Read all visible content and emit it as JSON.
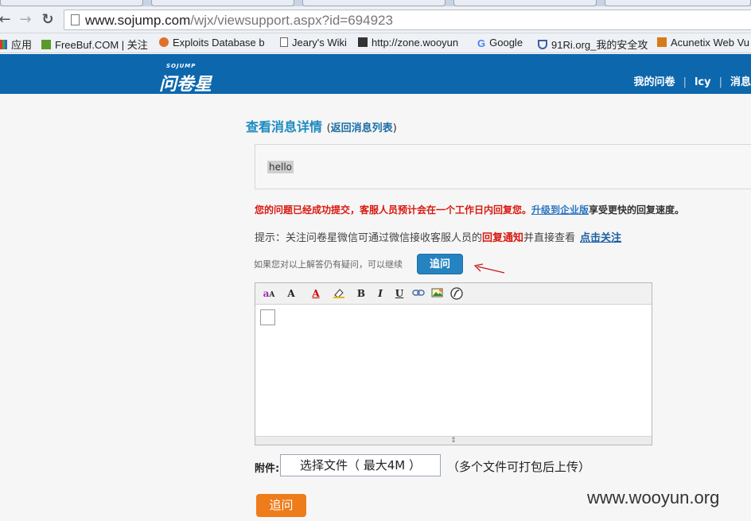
{
  "browser": {
    "url_host": "www.sojump.com",
    "url_path": "/wjx/viewsupport.aspx?id=694923",
    "back_glyph": "←",
    "forward_glyph": "→",
    "reload_glyph": "↻",
    "bookmarks": [
      {
        "label": "应用"
      },
      {
        "label": "FreeBuf.COM | 关注"
      },
      {
        "label": "Exploits Database b"
      },
      {
        "label": "Jeary's Wiki"
      },
      {
        "label": "http://zone.wooyun"
      },
      {
        "label": "Google"
      },
      {
        "label": "91Ri.org_我的安全攻"
      },
      {
        "label": "Acunetix Web Vu"
      }
    ]
  },
  "header": {
    "logo_tag": "SOJUMP",
    "logo_name": "问卷星",
    "nav": [
      "我的问卷",
      "lcy",
      "消息"
    ],
    "brand_color": "#0c67ad"
  },
  "page": {
    "title": "查看消息详情",
    "back_open": "(",
    "back_link": "返回消息列表",
    "back_close": ")",
    "message": "hello",
    "success_text": "您的问题已经成功提交，客服人员预计会在一个工作日内回复您。",
    "upgrade_link": "升级到企业版",
    "success_tail": "享受更快的回复速度。",
    "hint_prefix": "提示：关注问卷星微信可通过微信接收客服人员的",
    "hint_red": "回复通知",
    "hint_suffix": "并直接查看",
    "follow_link": "点击关注",
    "followup_prompt": "如果您对以上解答仍有疑问，可以继续",
    "followup_button": "追问",
    "toolbar": {
      "b": "B",
      "i": "I",
      "u": "U",
      "font_size": "A",
      "font_color": "A"
    },
    "resize_glyph": "↕",
    "attach_label": "附件:",
    "file_button": "选择文件（ 最大4M ）",
    "attach_note": "（多个文件可打包后上传）",
    "submit_button": "追问",
    "watermark": "www.wooyun.org"
  }
}
